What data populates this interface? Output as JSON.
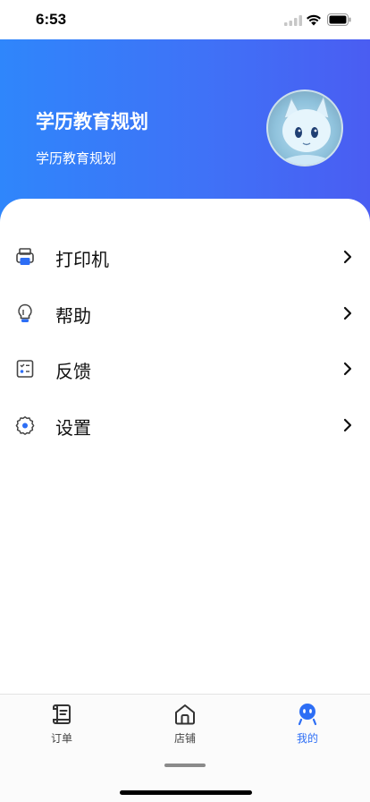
{
  "status_bar": {
    "time": "6:53"
  },
  "profile": {
    "name": "学历教育规划",
    "subtitle": "学历教育规划",
    "avatar_icon": "anime-cat-avatar"
  },
  "menu": {
    "items": [
      {
        "label": "打印机",
        "icon": "printer-icon"
      },
      {
        "label": "帮助",
        "icon": "lightbulb-icon"
      },
      {
        "label": "反馈",
        "icon": "checklist-icon"
      },
      {
        "label": "设置",
        "icon": "gear-icon"
      }
    ]
  },
  "tabbar": {
    "tabs": [
      {
        "label": "订单",
        "icon": "order-receipt-icon",
        "active": false
      },
      {
        "label": "店铺",
        "icon": "store-home-icon",
        "active": false
      },
      {
        "label": "我的",
        "icon": "profile-robot-icon",
        "active": true
      }
    ]
  },
  "colors": {
    "header_gradient_start": "#2f86fb",
    "header_gradient_end": "#4a5df2",
    "active_tab": "#2d6ef5"
  }
}
